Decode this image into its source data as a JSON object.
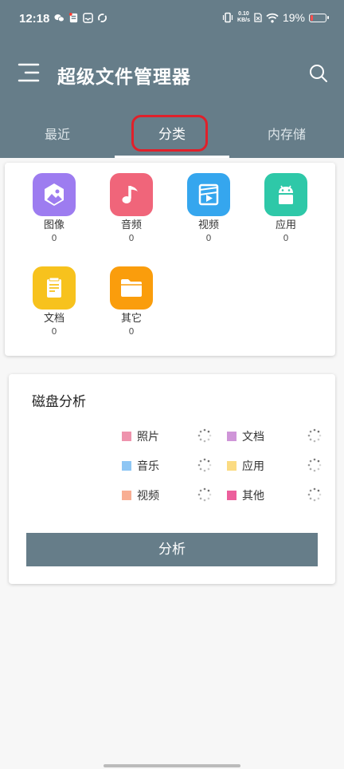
{
  "status_bar": {
    "time": "12:18",
    "net_speed_value": "0.10",
    "net_speed_unit": "KB/s",
    "battery_percent": "19%",
    "battery_level": 0.19
  },
  "app_bar": {
    "title": "超级文件管理器"
  },
  "tabs": [
    {
      "label": "最近"
    },
    {
      "label": "分类"
    },
    {
      "label": "内存储"
    }
  ],
  "active_tab": "分类",
  "categories": [
    {
      "label": "图像",
      "count": "0",
      "color": "#9d7cf0",
      "icon": "image-icon"
    },
    {
      "label": "音频",
      "count": "0",
      "color": "#f0657a",
      "icon": "music-note-icon"
    },
    {
      "label": "视频",
      "count": "0",
      "color": "#35a6ee",
      "icon": "video-icon"
    },
    {
      "label": "应用",
      "count": "0",
      "color": "#2ec8a8",
      "icon": "android-icon"
    },
    {
      "label": "文档",
      "count": "0",
      "color": "#f7c21d",
      "icon": "document-icon"
    },
    {
      "label": "其它",
      "count": "0",
      "color": "#fa9d0c",
      "icon": "folder-icon"
    }
  ],
  "disk_analysis": {
    "title": "磁盘分析",
    "legend": [
      {
        "label": "照片",
        "color": "#ee93ad"
      },
      {
        "label": "文档",
        "color": "#cf95d8"
      },
      {
        "label": "音乐",
        "color": "#8ec6f4"
      },
      {
        "label": "应用",
        "color": "#fbdb82"
      },
      {
        "label": "视频",
        "color": "#f8ae93"
      },
      {
        "label": "其他",
        "color": "#ec5f9c"
      }
    ],
    "button_label": "分析"
  },
  "colors": {
    "primary": "#667d89",
    "highlight_box": "#e0202a"
  }
}
